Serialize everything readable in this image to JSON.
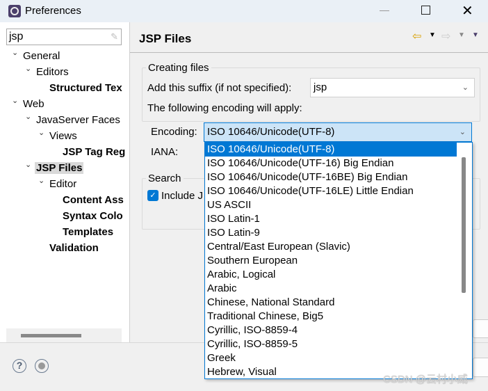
{
  "window": {
    "title": "Preferences",
    "icon": "eclipse-gear-icon"
  },
  "left": {
    "filter_value": "jsp",
    "tree": [
      {
        "label": "General",
        "bold": false,
        "expanded": true
      },
      {
        "label": "Editors",
        "bold": false,
        "expanded": true
      },
      {
        "label": "Structured Tex",
        "bold": true
      },
      {
        "label": "Web",
        "bold": false,
        "expanded": true
      },
      {
        "label": "JavaServer Faces",
        "bold": false,
        "expanded": true
      },
      {
        "label": "Views",
        "bold": false,
        "expanded": true
      },
      {
        "label": "JSP Tag Reg",
        "bold": true
      },
      {
        "label": "JSP Files",
        "bold": true,
        "selected": true,
        "expanded": true
      },
      {
        "label": "Editor",
        "bold": false,
        "expanded": true
      },
      {
        "label": "Content Ass",
        "bold": true
      },
      {
        "label": "Syntax Colo",
        "bold": true
      },
      {
        "label": "Templates",
        "bold": true
      },
      {
        "label": "Validation",
        "bold": true
      }
    ]
  },
  "page": {
    "title": "JSP Files",
    "creating_files": {
      "label": "Creating files",
      "suffix_label": "Add this suffix (if not specified):",
      "suffix_value": "jsp",
      "encoding_note": "The following encoding will apply:",
      "encoding_label": "Encoding:",
      "encoding_value": "ISO 10646/Unicode(UTF-8)",
      "iana_label": "IANA:"
    },
    "search": {
      "label": "Search",
      "checkbox_label": "Include J",
      "checked": true
    }
  },
  "encoding_options": [
    "ISO 10646/Unicode(UTF-8)",
    "ISO 10646/Unicode(UTF-16) Big Endian",
    "ISO 10646/Unicode(UTF-16BE) Big Endian",
    "ISO 10646/Unicode(UTF-16LE) Little Endian",
    "US ASCII",
    "ISO Latin-1",
    "ISO Latin-9",
    "Central/East European (Slavic)",
    "Southern European",
    "Arabic, Logical",
    "Arabic",
    "Chinese, National Standard",
    "Traditional Chinese, Big5",
    "Cyrillic, ISO-8859-4",
    "Cyrillic, ISO-8859-5",
    "Greek",
    "Hebrew, Visual"
  ],
  "watermark": "CSDN @云村小威",
  "colors": {
    "accent": "#0078d4",
    "combo_focus_bg": "#cce4f7"
  }
}
